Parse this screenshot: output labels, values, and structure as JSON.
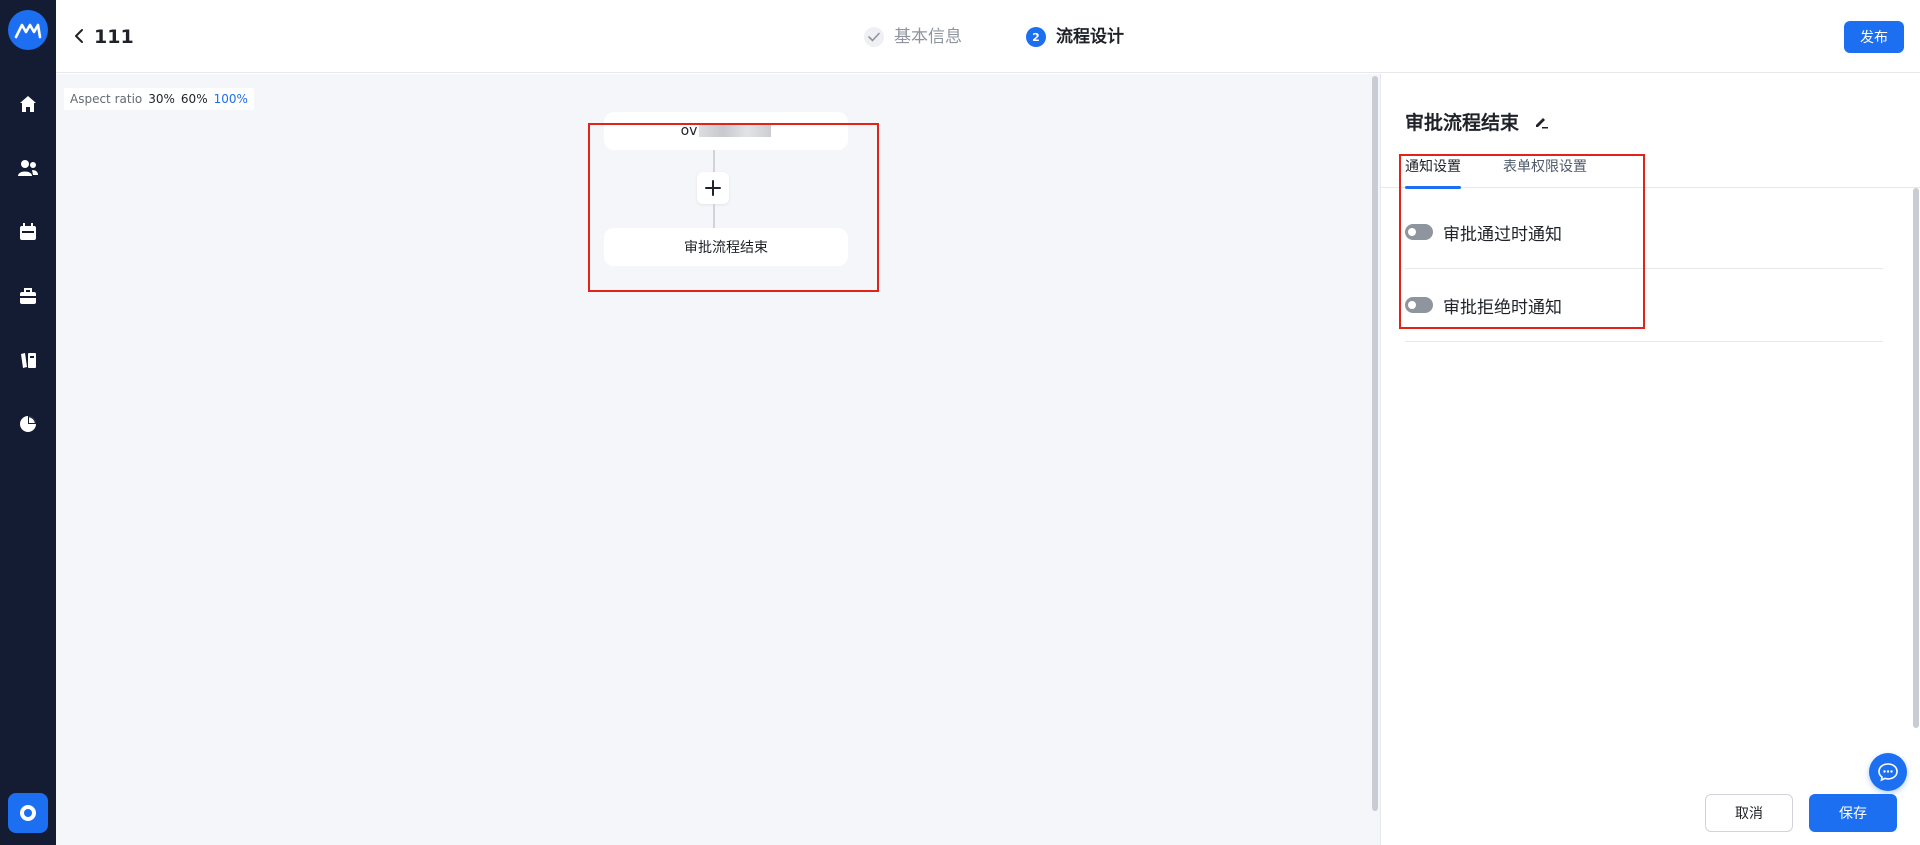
{
  "header": {
    "title": "111",
    "steps": [
      {
        "label": "基本信息",
        "status": "done"
      },
      {
        "label": "流程设计",
        "number": "2",
        "status": "active"
      }
    ],
    "publish_label": "发布"
  },
  "sidebar": {
    "items": [
      {
        "icon": "home-icon"
      },
      {
        "icon": "users-icon"
      },
      {
        "icon": "calendar-icon"
      },
      {
        "icon": "briefcase-icon"
      },
      {
        "icon": "books-icon"
      },
      {
        "icon": "pie-chart-icon"
      }
    ],
    "bottom_icon": "settings-icon"
  },
  "canvas": {
    "aspect_ratio_label": "Aspect ratio",
    "ratio_options": [
      "30%",
      "60%",
      "100%"
    ],
    "active_ratio": "100%",
    "start_node_text": "ov",
    "end_node_text": "审批流程结束",
    "add_icon": "plus-icon"
  },
  "panel": {
    "title": "审批流程结束",
    "tabs": [
      "通知设置",
      "表单权限设置"
    ],
    "active_tab": "通知设置",
    "settings": [
      {
        "label": "审批通过时通知",
        "enabled": false
      },
      {
        "label": "审批拒绝时通知",
        "enabled": false
      }
    ],
    "cancel_label": "取消",
    "save_label": "保存"
  },
  "colors": {
    "accent": "#1d6ff2",
    "sidebar_bg": "#141c33",
    "canvas_bg": "#f5f6fa",
    "highlight_box": "#e2231a"
  }
}
